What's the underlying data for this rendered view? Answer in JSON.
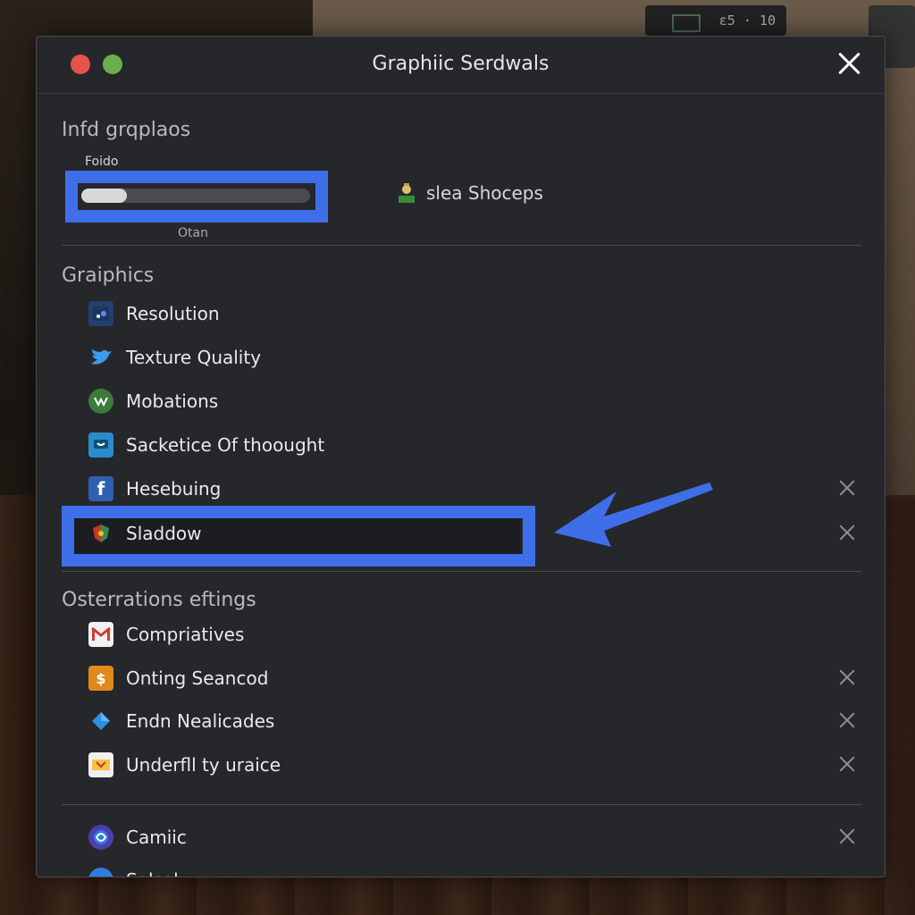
{
  "background": {
    "badge_text": "ε5 · 10"
  },
  "window": {
    "title": "Graphiic Serdwals",
    "accent_color": "#3f6fe8"
  },
  "top_section": {
    "heading": "Infd grqplaos",
    "slider_label": "Foido",
    "slider_caption": "Otan",
    "slider_value": 0.2,
    "plugin_label": "slea Shoceps"
  },
  "graphics": {
    "heading": "Graiphics",
    "items": [
      {
        "label": "Resolution",
        "icon": "monitor-icon",
        "removable": false
      },
      {
        "label": "Texture Quality",
        "icon": "bird-icon",
        "removable": false
      },
      {
        "label": "Mobations",
        "icon": "vine-icon",
        "removable": false
      },
      {
        "label": "Sacketice Of thoought",
        "icon": "chat-bubble-icon",
        "removable": false
      },
      {
        "label": "Hesebuing",
        "icon": "f-letter-icon",
        "removable": true
      },
      {
        "label": "Sladdow",
        "icon": "shield-icon",
        "removable": true,
        "highlighted": true
      }
    ]
  },
  "other": {
    "heading": "Osterrations eftings",
    "items": [
      {
        "label": "Compriatives",
        "icon": "mail-icon",
        "removable": false
      },
      {
        "label": "Onting Seancod",
        "icon": "coin-icon",
        "removable": true
      },
      {
        "label": "Endn Nealicades",
        "icon": "diamond-icon",
        "removable": true
      },
      {
        "label": "Underfll ty uraice",
        "icon": "ticket-icon",
        "removable": true
      }
    ]
  },
  "bottom": {
    "items": [
      {
        "label": "Camiic",
        "icon": "globe-icon",
        "removable": true
      },
      {
        "label": "Salsol",
        "icon": "globe-small-icon",
        "removable": false
      }
    ]
  }
}
